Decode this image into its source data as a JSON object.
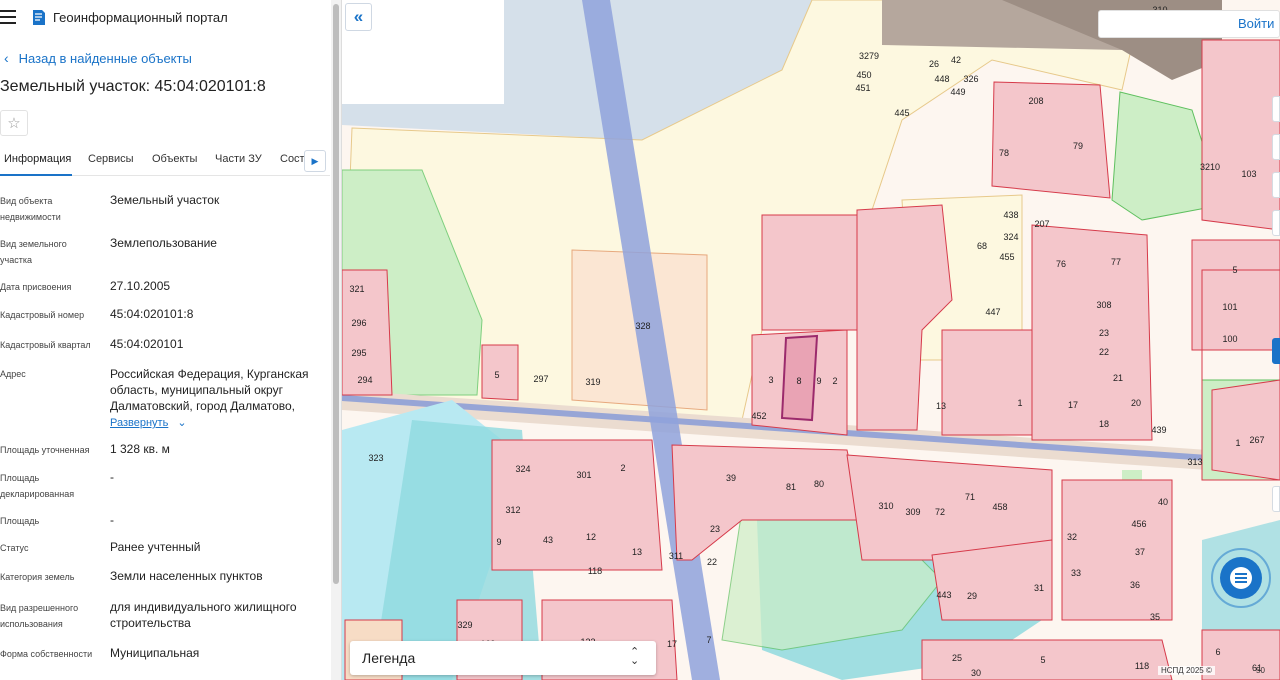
{
  "portal": {
    "title": "Геоинформационный портал"
  },
  "nav": {
    "back_label": "Назад в найденные объекты"
  },
  "object": {
    "title": "Земельный участок: 45:04:020101:8"
  },
  "tabs": [
    {
      "label": "Информация"
    },
    {
      "label": "Сервисы"
    },
    {
      "label": "Объекты"
    },
    {
      "label": "Части ЗУ"
    },
    {
      "label": "Состав"
    }
  ],
  "info": [
    {
      "label": "Вид объекта недвижимости",
      "value": "Земельный участок"
    },
    {
      "label": "Вид земельного участка",
      "value": "Землепользование"
    },
    {
      "label": "Дата присвоения",
      "value": "27.10.2005"
    },
    {
      "label": "Кадастровый номер",
      "value": "45:04:020101:8"
    },
    {
      "label": "Кадастровый квартал",
      "value": "45:04:020101"
    },
    {
      "label": "Адрес",
      "value": "Российская Федерация, Курганская область, муниципальный округ Далматовский, город Далматово,"
    },
    {
      "label": "Площадь уточненная",
      "value": "1 328 кв. м"
    },
    {
      "label": "Площадь декларированная",
      "value": "-"
    },
    {
      "label": "Площадь",
      "value": "-"
    },
    {
      "label": "Статус",
      "value": "Ранее учтенный"
    },
    {
      "label": "Категория земель",
      "value": "Земли населенных пунктов"
    },
    {
      "label": "Вид разрешенного использования",
      "value": "для индивидуального жилищного строительства"
    },
    {
      "label": "Форма собственности",
      "value": "Муниципальная"
    }
  ],
  "expand_label": "Развернуть",
  "map": {
    "login_label": "Войти",
    "legend_label": "Легенда",
    "copyright": "НСПД 2025 ©",
    "scale": "50",
    "parcel_labels": [
      "310",
      "3279",
      "42",
      "450",
      "26",
      "448",
      "326",
      "451",
      "449",
      "445",
      "208",
      "78",
      "79",
      "3210",
      "103",
      "438",
      "207",
      "324",
      "68",
      "455",
      "76",
      "77",
      "5",
      "321",
      "101",
      "308",
      "447",
      "296",
      "23",
      "100",
      "328",
      "22",
      "295",
      "3",
      "8",
      "9",
      "2",
      "5",
      "297",
      "319",
      "21",
      "294",
      "13",
      "1",
      "17",
      "20",
      "452",
      "18",
      "439",
      "1",
      "267",
      "323",
      "313",
      "324",
      "301",
      "2",
      "39",
      "81",
      "80",
      "310",
      "309",
      "72",
      "71",
      "458",
      "40",
      "312",
      "9",
      "43",
      "12",
      "13",
      "118",
      "311",
      "23",
      "22",
      "456",
      "32",
      "37",
      "33",
      "36",
      "35",
      "443",
      "29",
      "31",
      "329",
      "169",
      "123",
      "17",
      "7",
      "25",
      "30",
      "5",
      "118",
      "6",
      "61"
    ]
  },
  "colors": {
    "accent": "#1a73c8",
    "parcel_fill": "#f4c6cb",
    "parcel_stroke": "#d63a4a",
    "green_zone": "#c9ebc3",
    "water": "#8fd9de",
    "corridor": "#8fa2dc"
  },
  "icons": {
    "menu": "menu-icon",
    "logo": "logo-icon",
    "back": "chevron-left-icon",
    "star": "star-icon",
    "collapse": "double-chevron-left-icon",
    "chat": "chat-icon",
    "sort": "sort-arrows-icon"
  }
}
